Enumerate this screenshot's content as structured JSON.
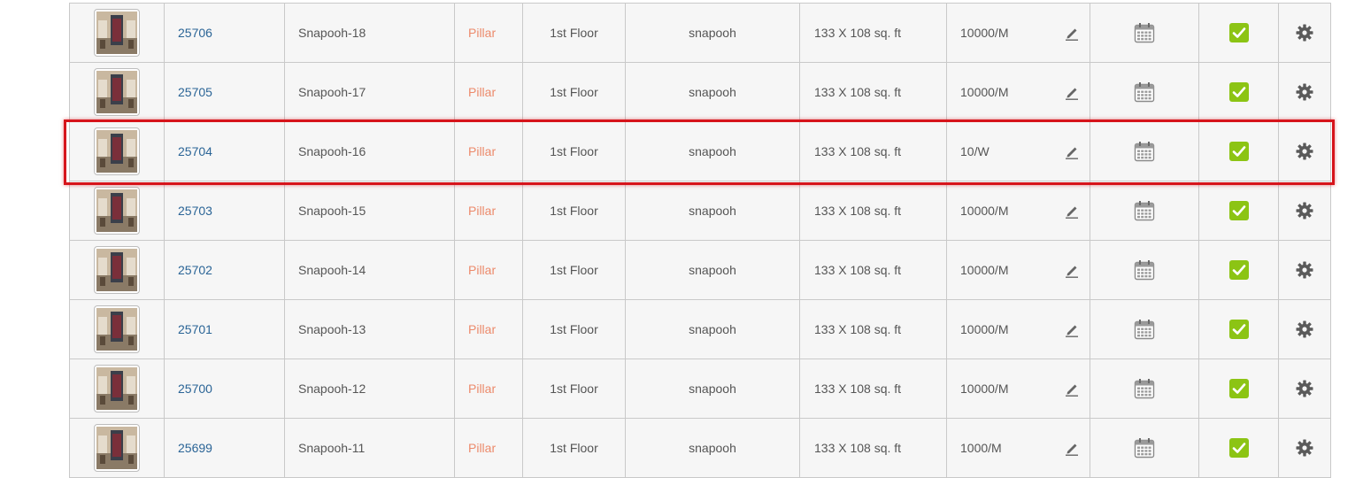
{
  "colors": {
    "link": "#2a6496",
    "type_text": "#ec8a6b",
    "row_bg": "#f6f6f6",
    "border": "#c9c9c9",
    "check_green": "#8cc414",
    "highlight": "#d6141b"
  },
  "icons": {
    "edit": "pencil-icon",
    "calendar": "calendar-icon",
    "available": "checkbox-checked-icon",
    "settings": "gear-icon"
  },
  "listings": [
    {
      "id": "25706",
      "name": "Snapooh-18",
      "type": "Pillar",
      "floor": "1st Floor",
      "owner": "snapooh",
      "size": "133 X 108 sq. ft",
      "price": "10000/M",
      "highlighted": false
    },
    {
      "id": "25705",
      "name": "Snapooh-17",
      "type": "Pillar",
      "floor": "1st Floor",
      "owner": "snapooh",
      "size": "133 X 108 sq. ft",
      "price": "10000/M",
      "highlighted": false
    },
    {
      "id": "25704",
      "name": "Snapooh-16",
      "type": "Pillar",
      "floor": "1st Floor",
      "owner": "snapooh",
      "size": "133 X 108 sq. ft",
      "price": "10/W",
      "highlighted": true
    },
    {
      "id": "25703",
      "name": "Snapooh-15",
      "type": "Pillar",
      "floor": "1st Floor",
      "owner": "snapooh",
      "size": "133 X 108 sq. ft",
      "price": "10000/M",
      "highlighted": false
    },
    {
      "id": "25702",
      "name": "Snapooh-14",
      "type": "Pillar",
      "floor": "1st Floor",
      "owner": "snapooh",
      "size": "133 X 108 sq. ft",
      "price": "10000/M",
      "highlighted": false
    },
    {
      "id": "25701",
      "name": "Snapooh-13",
      "type": "Pillar",
      "floor": "1st Floor",
      "owner": "snapooh",
      "size": "133 X 108 sq. ft",
      "price": "10000/M",
      "highlighted": false
    },
    {
      "id": "25700",
      "name": "Snapooh-12",
      "type": "Pillar",
      "floor": "1st Floor",
      "owner": "snapooh",
      "size": "133 X 108 sq. ft",
      "price": "10000/M",
      "highlighted": false
    },
    {
      "id": "25699",
      "name": "Snapooh-11",
      "type": "Pillar",
      "floor": "1st Floor",
      "owner": "snapooh",
      "size": "133 X 108 sq. ft",
      "price": "1000/M",
      "highlighted": false
    }
  ]
}
